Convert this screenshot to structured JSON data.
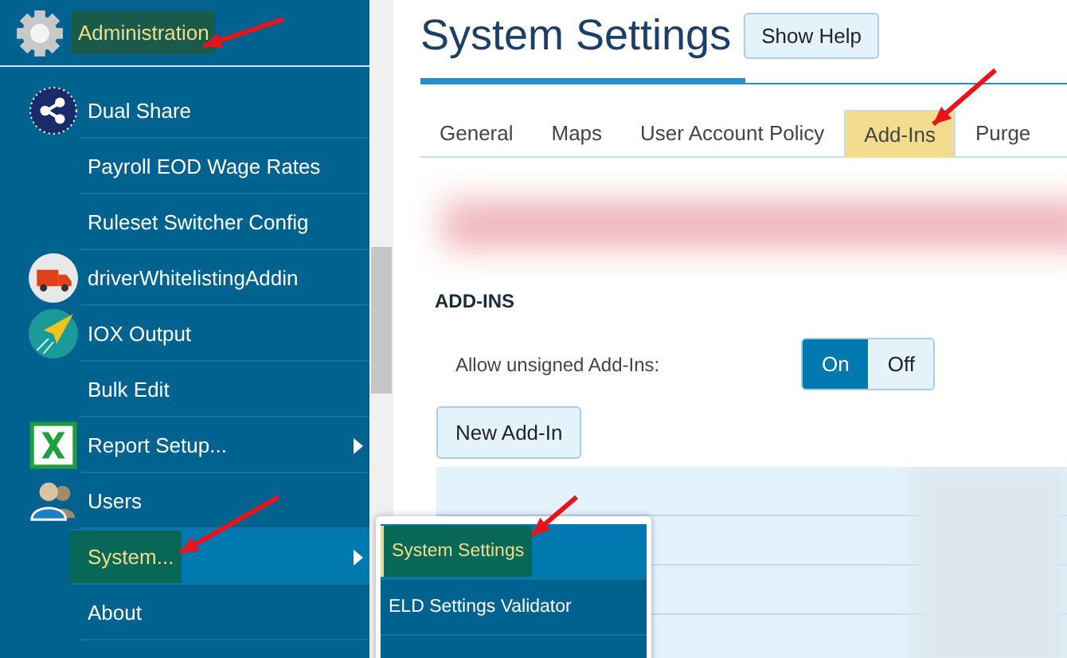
{
  "sidebar": {
    "header": {
      "label": "Administration",
      "selected": true
    },
    "items": [
      {
        "label": "Dual Share",
        "kind": "share",
        "submenu": false,
        "selected": false
      },
      {
        "label": "Payroll EOD Wage Rates",
        "kind": "plain",
        "submenu": false,
        "selected": false
      },
      {
        "label": "Ruleset Switcher Config",
        "kind": "plain",
        "submenu": false,
        "selected": false
      },
      {
        "label": "driverWhitelistingAddin",
        "kind": "truck",
        "submenu": false,
        "selected": false
      },
      {
        "label": "IOX Output",
        "kind": "plane",
        "submenu": false,
        "selected": false
      },
      {
        "label": "Bulk Edit",
        "kind": "plain",
        "submenu": false,
        "selected": false
      },
      {
        "label": "Report Setup...",
        "kind": "sheet",
        "submenu": true,
        "selected": false
      },
      {
        "label": "Users",
        "kind": "users",
        "submenu": false,
        "selected": false
      },
      {
        "label": "System...",
        "kind": "plain",
        "submenu": true,
        "selected": true
      },
      {
        "label": "About",
        "kind": "plain",
        "submenu": false,
        "selected": false
      }
    ]
  },
  "submenu": {
    "items": [
      {
        "label": "System Settings",
        "selected": true
      },
      {
        "label": "ELD Settings Validator",
        "selected": false
      }
    ]
  },
  "page": {
    "title": "System Settings",
    "help_button": "Show Help",
    "tabs": [
      {
        "label": "General",
        "selected": false
      },
      {
        "label": "Maps",
        "selected": false
      },
      {
        "label": "User Account Policy",
        "selected": false
      },
      {
        "label": "Add-Ins",
        "selected": true
      },
      {
        "label": "Purge",
        "selected": false
      }
    ],
    "section_title": "ADD-INS",
    "setting": {
      "label": "Allow unsigned Add-Ins:",
      "options": [
        {
          "label": "On",
          "selected": true
        },
        {
          "label": "Off",
          "selected": false
        }
      ]
    },
    "new_button": "New Add-In"
  }
}
